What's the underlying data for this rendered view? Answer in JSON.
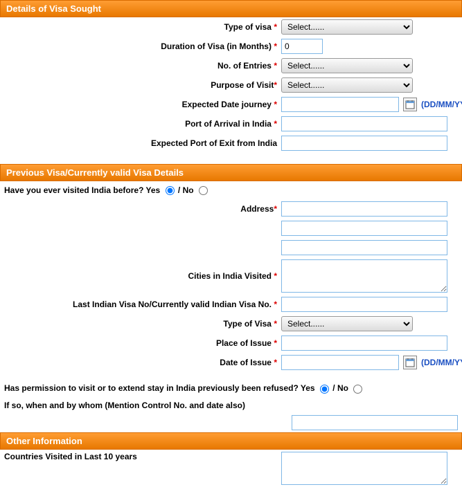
{
  "section1": {
    "title": "Details of Visa Sought",
    "type_of_visa_label": "Type of visa",
    "type_of_visa_placeholder": "Select......",
    "duration_label": "Duration of Visa (in Months)",
    "duration_value": "0",
    "entries_label": "No. of Entries",
    "entries_placeholder": "Select......",
    "purpose_label": "Purpose of Visit",
    "purpose_placeholder": "Select......",
    "expected_date_label": "Expected Date journey",
    "date_hint": "(DD/MM/YYYY)",
    "port_arrival_label": "Port of Arrival in India",
    "port_exit_label": "Expected Port of Exit from India"
  },
  "section2": {
    "title": "Previous Visa/Currently valid Visa Details",
    "visited_q": "Have you ever visited India before?",
    "yes": "Yes",
    "no": "No",
    "slash": " / ",
    "address_label": "Address",
    "cities_label": "Cities in India Visited",
    "last_visa_label": "Last Indian Visa No/Currently valid Indian Visa No.",
    "type_of_visa_label": "Type of Visa",
    "type_of_visa_placeholder": "Select......",
    "place_issue_label": "Place of Issue",
    "date_issue_label": "Date of Issue",
    "date_hint": "(DD/MM/YYYY)",
    "refused_q": "Has permission to visit or to extend stay in India previously been refused?",
    "ifso_label": "If so, when and by whom (Mention Control No. and date also)"
  },
  "section3": {
    "title": "Other Information",
    "countries_label": "Countries Visited in Last 10 years"
  }
}
